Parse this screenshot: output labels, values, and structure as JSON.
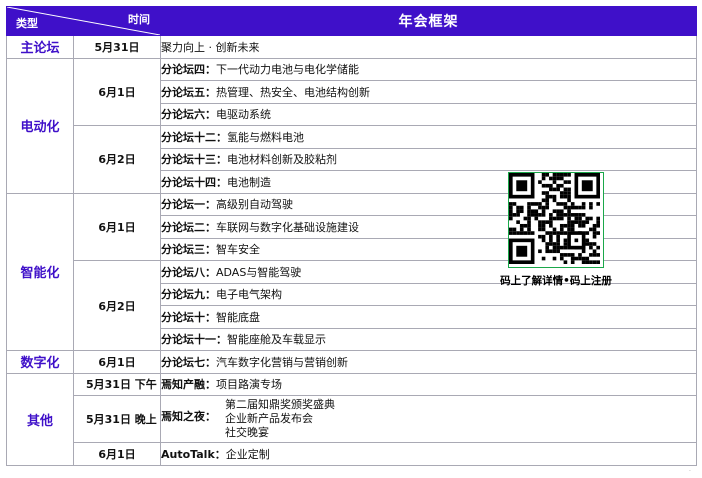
{
  "header": {
    "type_label": "类型",
    "time_label": "时间",
    "title": "年会框架"
  },
  "colors": {
    "accent": "#3f10c9",
    "qr_border": "#1aa84a"
  },
  "categories": {
    "main": "主论坛",
    "ev": "电动化",
    "smart": "智能化",
    "digital": "数字化",
    "other": "其他"
  },
  "rows": {
    "r1": {
      "date": "5月31日",
      "prefix": "",
      "text": "聚力向上 · 创新未来"
    },
    "r2": {
      "date": "6月1日",
      "prefix": "分论坛四：",
      "text": "下一代动力电池与电化学储能"
    },
    "r3": {
      "prefix": "分论坛五：",
      "text": "热管理、热安全、电池结构创新"
    },
    "r4": {
      "prefix": "分论坛六：",
      "text": "电驱动系统"
    },
    "r5": {
      "date": "6月2日",
      "prefix": "分论坛十二：",
      "text": "氢能与燃料电池"
    },
    "r6": {
      "prefix": "分论坛十三：",
      "text": "电池材料创新及胶粘剂"
    },
    "r7": {
      "prefix": "分论坛十四：",
      "text": "电池制造"
    },
    "r8": {
      "date": "6月1日",
      "prefix": "分论坛一：",
      "text": "高级别自动驾驶"
    },
    "r9": {
      "prefix": "分论坛二：",
      "text": "车联网与数字化基础设施建设"
    },
    "r10": {
      "prefix": "分论坛三：",
      "text": "智车安全"
    },
    "r11": {
      "date": "6月2日",
      "prefix": "分论坛八：",
      "text": "ADAS与智能驾驶"
    },
    "r12": {
      "prefix": "分论坛九：",
      "text": "电子电气架构"
    },
    "r13": {
      "prefix": "分论坛十：",
      "text": "智能底盘"
    },
    "r14": {
      "prefix": "分论坛十一：",
      "text": "智能座舱及车载显示"
    },
    "r15": {
      "date": "6月1日",
      "prefix": "分论坛七：",
      "text": "汽车数字化营销与营销创新"
    },
    "r16": {
      "date": "5月31日 下午",
      "prefix": "焉知产融：",
      "text": "项目路演专场"
    },
    "r17": {
      "date": "5月31日 晚上",
      "prefix": "焉知之夜：",
      "lines": [
        "第二届知鼎奖颁奖盛典",
        "企业新产品发布会",
        "社交晚宴"
      ]
    },
    "r18": {
      "date": "6月1日",
      "prefix": "AutoTalk：",
      "text": "企业定制"
    }
  },
  "qr": {
    "caption": "码上了解详情•码上注册"
  }
}
